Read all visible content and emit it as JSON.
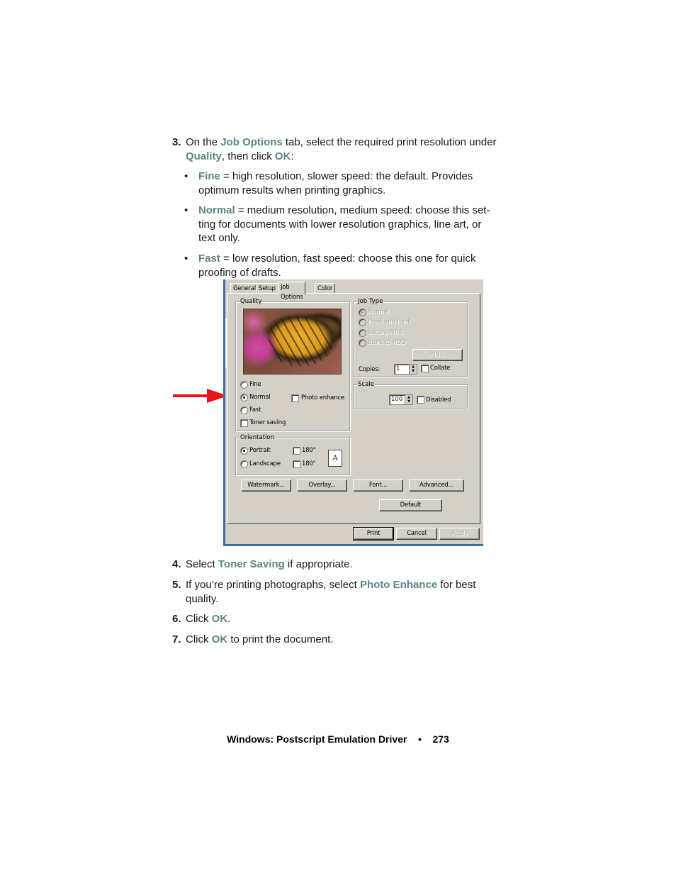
{
  "accent_color": "#5b8585",
  "arrow_color": "#e8141c",
  "steps": [
    {
      "num": "3.",
      "parts": [
        "On the ",
        "Job Options",
        " tab, select the required print resolution under",
        "Quality",
        ", then click ",
        "OK",
        ":"
      ]
    },
    {
      "num": "4.",
      "parts": [
        "Select ",
        "Toner Saving",
        " if appropriate."
      ]
    },
    {
      "num": "5.",
      "parts": [
        "If you’re printing photographs, select ",
        "Photo Enhance",
        " for best",
        "quality."
      ]
    },
    {
      "num": "6.",
      "parts": [
        "Click ",
        "OK",
        "."
      ]
    },
    {
      "num": "7.",
      "parts": [
        "Click ",
        "OK",
        " to print the document."
      ]
    }
  ],
  "bullets": [
    {
      "dot": "•",
      "term": "Fine",
      "line1": " = high resolution, slower speed: the default. Provides",
      "line2": "optimum results when printing graphics."
    },
    {
      "dot": "•",
      "term": "Normal",
      "line1": " = medium resolution, medium speed: choose this set-",
      "line2": "ting for documents with lower resolution graphics, line art, or",
      "line3": "text only."
    },
    {
      "dot": "•",
      "term": "Fast",
      "line1": " = low resolution, fast speed: choose this one for quick",
      "line2": "proofing of drafts."
    }
  ],
  "dialog": {
    "tabs": [
      "General",
      "Setup",
      "Job Options",
      "Color"
    ],
    "active_tab": "Job Options",
    "quality": {
      "legend": "Quality",
      "image": "monarch-butterfly-preview",
      "options": [
        "Fine",
        "Normal",
        "Fast"
      ],
      "selected": "Normal",
      "photo_enhance_label": "Photo enhance",
      "photo_enhance_checked": false,
      "toner_saving_label": "Toner saving",
      "toner_saving_checked": false
    },
    "job_type": {
      "legend": "Job Type",
      "options": [
        "Normal",
        "Proof and Print",
        "Secure Print",
        "Store to HDD"
      ],
      "selected": "Normal",
      "disabled": true,
      "pin_button": "PIN...",
      "copies_label": "Copies:",
      "copies_value": "1",
      "collate_label": "Collate",
      "collate_checked": false
    },
    "scale": {
      "legend": "Scale",
      "value": "100",
      "disabled_label": "Disabled",
      "disabled_checked": false
    },
    "orientation": {
      "legend": "Orientation",
      "options": [
        "Portrait",
        "Landscape"
      ],
      "selected": "Portrait",
      "rotate_label": "180°",
      "preview_letter": "A"
    },
    "buttons": {
      "watermark": "Watermark...",
      "overlay": "Overlay...",
      "font": "Font...",
      "advanced": "Advanced...",
      "default": "Default",
      "print": "Print",
      "cancel": "Cancel",
      "apply": "Apply"
    }
  },
  "footer": {
    "title": "Windows: Postscript Emulation Driver",
    "separator": "•",
    "page": "273"
  }
}
